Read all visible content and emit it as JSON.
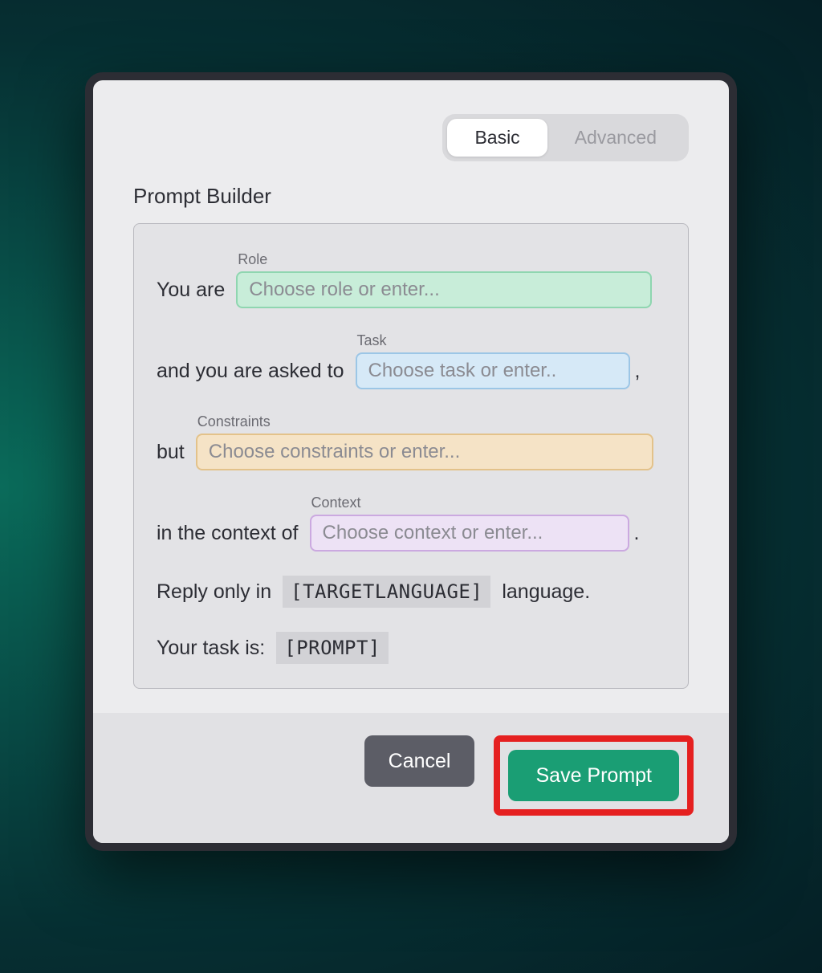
{
  "tabs": {
    "basic": "Basic",
    "advanced": "Advanced"
  },
  "title": "Prompt Builder",
  "builder": {
    "line1_prefix": "You are",
    "role_label": "Role",
    "role_placeholder": "Choose role or enter...",
    "line2_prefix": "and you are asked to",
    "task_label": "Task",
    "task_placeholder": "Choose task or enter..",
    "line2_suffix": ",",
    "line3_prefix": "but",
    "constraints_label": "Constraints",
    "constraints_placeholder": "Choose constraints or enter...",
    "line4_prefix": "in the context of",
    "context_label": "Context",
    "context_placeholder": "Choose context or enter...",
    "line4_suffix": ".",
    "line5_prefix": "Reply only in",
    "line5_token": "[TARGETLANGUAGE]",
    "line5_suffix": "language.",
    "line6_prefix": "Your task is:",
    "line6_token": "[PROMPT]"
  },
  "footer": {
    "cancel": "Cancel",
    "save": "Save Prompt"
  }
}
